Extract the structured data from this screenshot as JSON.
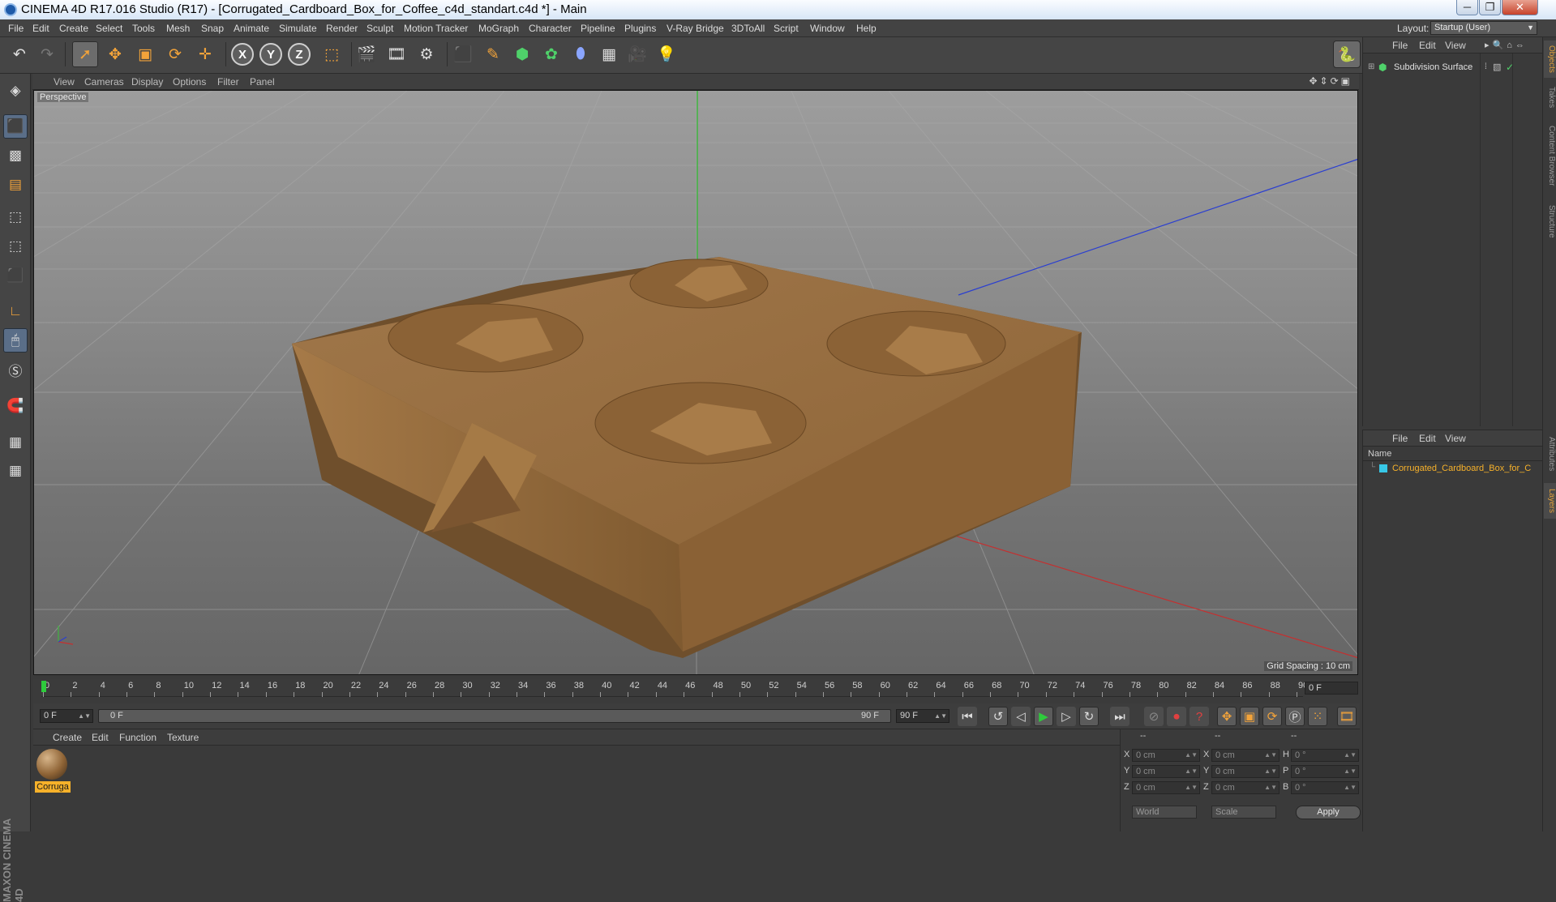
{
  "window": {
    "title": "CINEMA 4D R17.016 Studio (R17) - [Corrugated_Cardboard_Box_for_Coffee_c4d_standart.c4d *] - Main",
    "minimize": "─",
    "maximize": "❐",
    "close": "✕"
  },
  "menu": [
    "File",
    "Edit",
    "Create",
    "Select",
    "Tools",
    "Mesh",
    "Snap",
    "Animate",
    "Simulate",
    "Render",
    "Sculpt",
    "Motion Tracker",
    "MoGraph",
    "Character",
    "Pipeline",
    "Plugins",
    "V-Ray Bridge",
    "3DToAll",
    "Script",
    "Window",
    "Help"
  ],
  "layout": {
    "label": "Layout:",
    "value": "Startup (User)"
  },
  "toolbar": {
    "x": "X",
    "y": "Y",
    "z": "Z"
  },
  "viewport": {
    "menu": [
      "View",
      "Cameras",
      "Display",
      "Options",
      "Filter",
      "Panel"
    ],
    "label": "Perspective",
    "grid_spacing": "Grid Spacing : 10 cm",
    "nav_icons": "✥⇕⟳▣"
  },
  "timeline": {
    "ticks": [
      "0",
      "2",
      "4",
      "6",
      "8",
      "10",
      "12",
      "14",
      "16",
      "18",
      "20",
      "22",
      "24",
      "26",
      "28",
      "30",
      "32",
      "34",
      "36",
      "38",
      "40",
      "42",
      "44",
      "46",
      "48",
      "50",
      "52",
      "54",
      "56",
      "58",
      "60",
      "62",
      "64",
      "66",
      "68",
      "70",
      "72",
      "74",
      "76",
      "78",
      "80",
      "82",
      "84",
      "86",
      "88",
      "90"
    ],
    "current_frame": "0 F",
    "start_field": "0 F",
    "slider_start": "0 F",
    "slider_end": "90 F",
    "end_field": "90 F"
  },
  "materials": {
    "menu": [
      "Create",
      "Edit",
      "Function",
      "Texture"
    ],
    "items": [
      {
        "name": "Corruga"
      }
    ]
  },
  "coords": {
    "headers": [
      "--",
      "--",
      "--"
    ],
    "rows": [
      {
        "l1": "X",
        "v1": "0 cm",
        "l2": "X",
        "v2": "0 cm",
        "l3": "H",
        "v3": "0 °"
      },
      {
        "l1": "Y",
        "v1": "0 cm",
        "l2": "Y",
        "v2": "0 cm",
        "l3": "P",
        "v3": "0 °"
      },
      {
        "l1": "Z",
        "v1": "0 cm",
        "l2": "Z",
        "v2": "0 cm",
        "l3": "B",
        "v3": "0 °"
      }
    ],
    "mode1": "World",
    "mode2": "Scale",
    "apply": "Apply"
  },
  "objects": {
    "menu": [
      "File",
      "Edit",
      "View"
    ],
    "items": [
      {
        "name": "Subdivision Surface"
      }
    ]
  },
  "layers": {
    "menu": [
      "File",
      "Edit",
      "View"
    ],
    "column": "Name",
    "items": [
      {
        "name": "Corrugated_Cardboard_Box_for_C"
      }
    ]
  },
  "right_tabs": [
    "Objects",
    "Takes",
    "Content Browser",
    "Structure",
    "Attributes",
    "Layers"
  ],
  "logo": "MAXON CINEMA 4D",
  "colors": {
    "accent": "#f6a623",
    "selected_text": "#f6b12a",
    "playhead": "#2ecc3c"
  }
}
